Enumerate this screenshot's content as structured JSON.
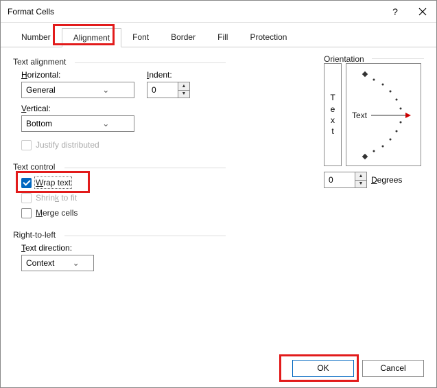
{
  "window": {
    "title": "Format Cells"
  },
  "tabs": {
    "items": [
      "Number",
      "Alignment",
      "Font",
      "Border",
      "Fill",
      "Protection"
    ],
    "active": "Alignment"
  },
  "textAlignment": {
    "label": "Text alignment",
    "horizontal": {
      "label_pre": "",
      "label_u": "H",
      "label_post": "orizontal:",
      "value": "General"
    },
    "vertical": {
      "label_pre": "",
      "label_u": "V",
      "label_post": "ertical:",
      "value": "Bottom"
    },
    "indent": {
      "label_pre": "",
      "label_u": "I",
      "label_post": "ndent:",
      "value": "0"
    },
    "justify": {
      "label": "Justify distributed"
    }
  },
  "textControl": {
    "label": "Text control",
    "wrap": {
      "label_u": "W",
      "label_post": "rap text",
      "checked": true
    },
    "shrink": {
      "label_pre": "Shrin",
      "label_u": "k",
      "label_post": " to fit"
    },
    "merge": {
      "label_u": "M",
      "label_post": "erge cells"
    }
  },
  "rtl": {
    "label": "Right-to-left",
    "textDirection": {
      "label_u": "T",
      "label_post": "ext direction:",
      "value": "Context"
    }
  },
  "orientation": {
    "label": "Orientation",
    "verticalText": [
      "T",
      "e",
      "x",
      "t"
    ],
    "dialLabel": "Text",
    "degrees": {
      "value": "0",
      "label_u": "D",
      "label_post": "egrees"
    }
  },
  "buttons": {
    "ok": "OK",
    "cancel": "Cancel"
  }
}
